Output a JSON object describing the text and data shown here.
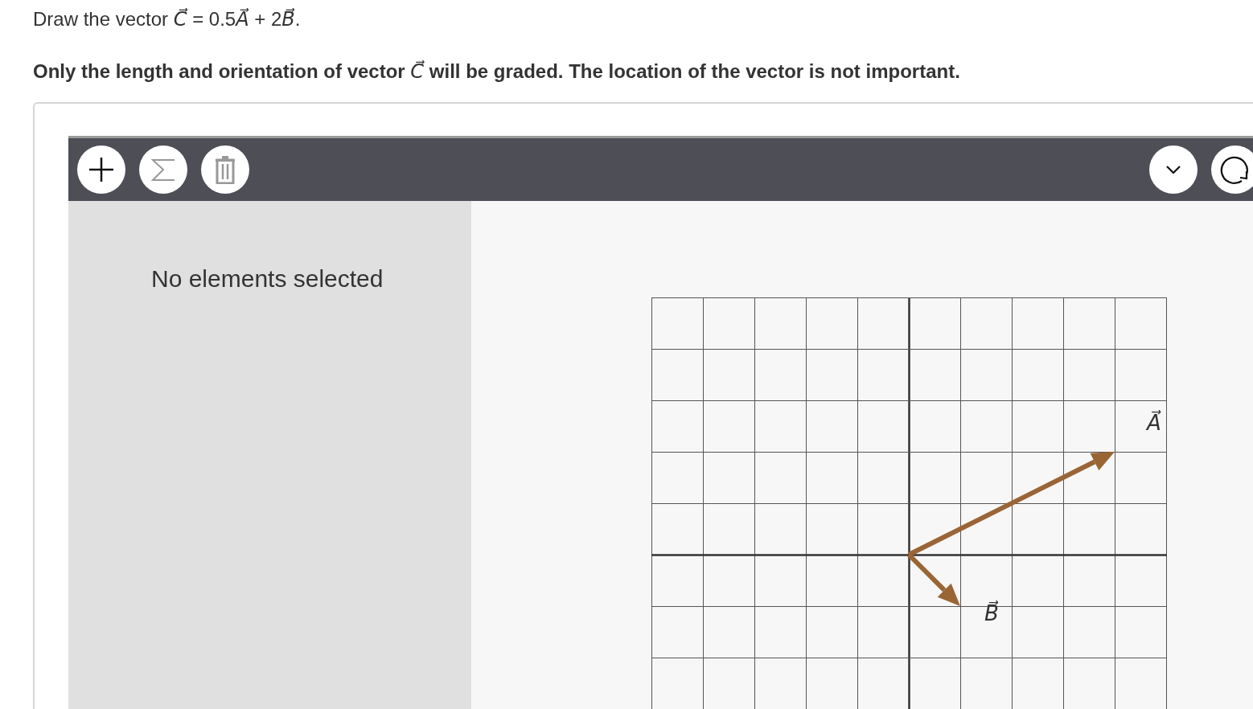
{
  "question": {
    "prompt": "Draw the vector C⃗ = 0.5A⃗ + 2B⃗.",
    "note": "Only the length and orientation of vector C⃗ will be graded. The location of the vector is not important."
  },
  "toolbar": {
    "left": [
      {
        "kind": "add",
        "disabled": false
      },
      {
        "kind": "sum",
        "disabled": true
      },
      {
        "kind": "delete",
        "disabled": true
      }
    ],
    "right": [
      {
        "kind": "collapse",
        "disabled": false
      },
      {
        "kind": "reset",
        "disabled": false
      }
    ]
  },
  "panel": {
    "message": "No elements selected"
  },
  "canvas": {
    "vectors": [
      {
        "label": "A⃗",
        "color": "#9a6535"
      },
      {
        "label": "B⃗",
        "color": "#9a6535"
      }
    ]
  }
}
